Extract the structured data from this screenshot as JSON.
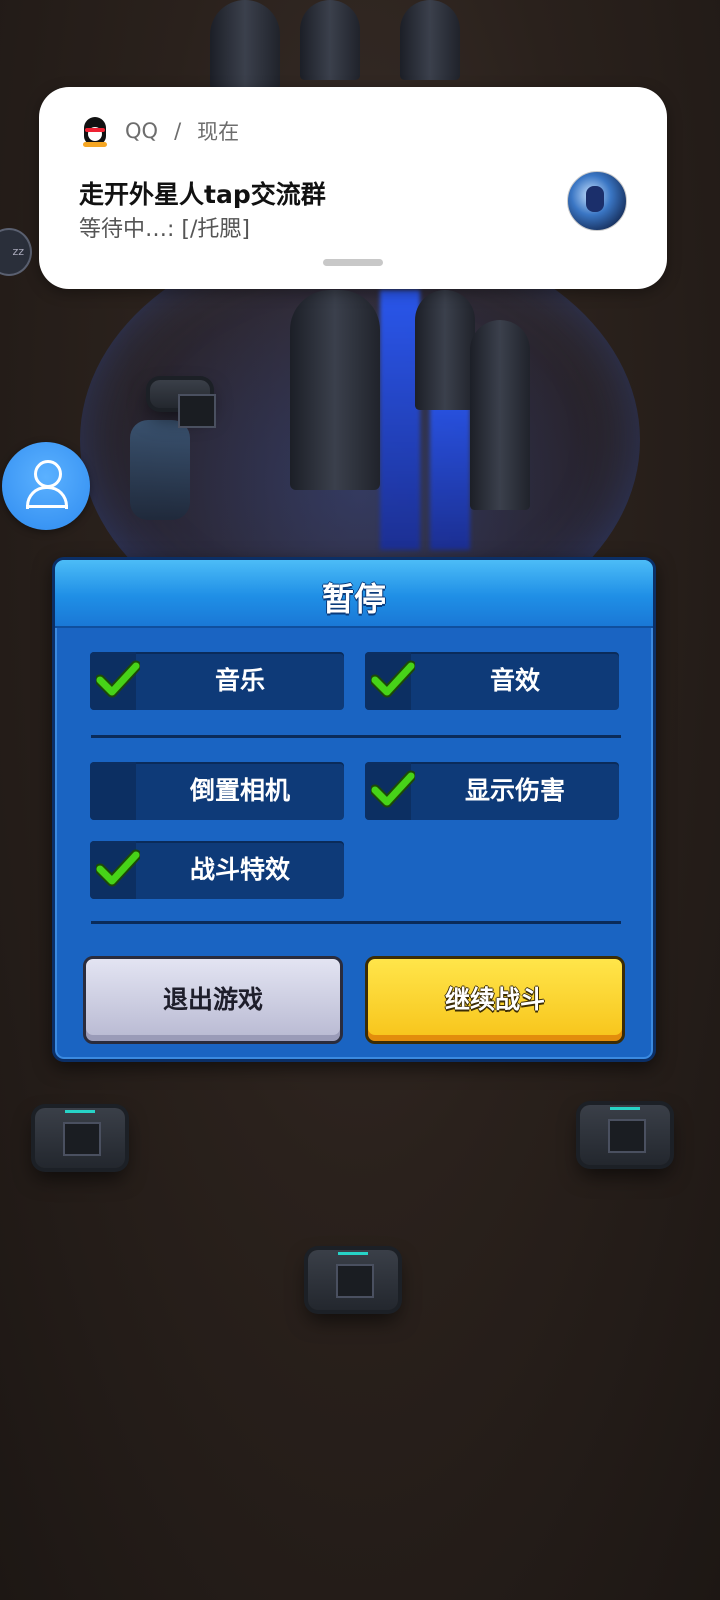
{
  "notification": {
    "app_name": "QQ",
    "separator": "/",
    "time": "现在",
    "title": "走开外星人tap交流群",
    "message": "等待中…: [/托腮]",
    "app_icon": "qq-penguin-icon",
    "avatar_icon": "group-avatar"
  },
  "side_badge": {
    "text": "zz"
  },
  "floating_button": {
    "icon": "user-icon"
  },
  "pause_dialog": {
    "title": "暂停",
    "options": [
      {
        "label": "音乐",
        "checked": true
      },
      {
        "label": "音效",
        "checked": true
      },
      {
        "label": "倒置相机",
        "checked": false
      },
      {
        "label": "显示伤害",
        "checked": true
      },
      {
        "label": "战斗特效",
        "checked": true
      }
    ],
    "buttons": {
      "exit": "退出游戏",
      "continue": "继续战斗"
    }
  },
  "colors": {
    "dialog_blue": "#1a64c2",
    "check_green": "#47d318",
    "continue_yellow": "#f7c41a",
    "exit_gray": "#c9cade"
  }
}
